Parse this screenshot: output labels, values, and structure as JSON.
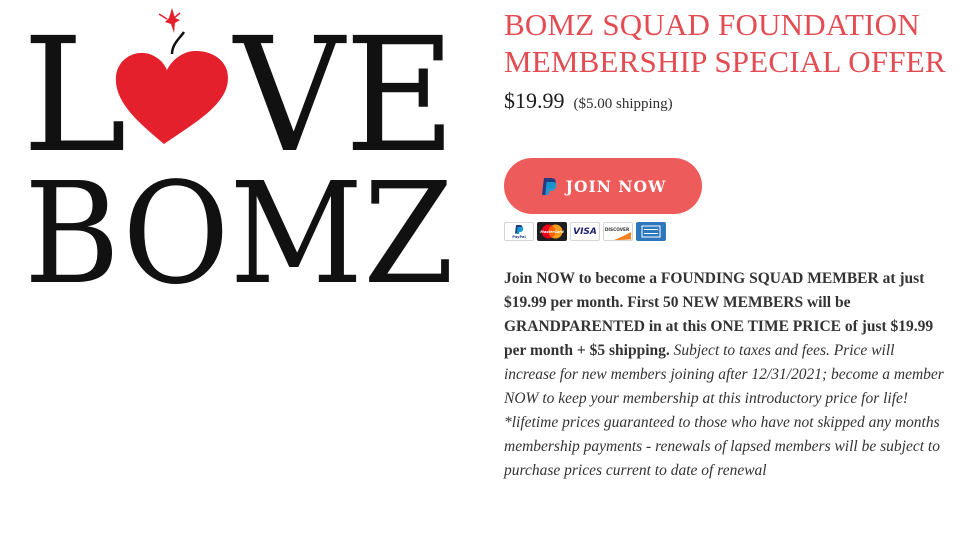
{
  "logo": {
    "line1_start": "L",
    "line1_end": "VE",
    "line2": "BOMZ",
    "heart_color": "#e3202c",
    "icon": "bomb-heart-icon"
  },
  "product": {
    "title_line1": "BOMZ SQUAD FOUNDATION",
    "title_line2": "MEMBERSHIP SPECIAL OFFER",
    "price": "$19.99",
    "shipping": "($5.00 shipping)",
    "join_label": "JOIN NOW",
    "accent_color": "#ee5b5b"
  },
  "payment_cards": [
    {
      "name": "paypal-card-icon",
      "label": "PayPal"
    },
    {
      "name": "mastercard-card-icon",
      "label": "MasterCard"
    },
    {
      "name": "visa-card-icon",
      "label": "VISA"
    },
    {
      "name": "discover-card-icon",
      "label": "DISCOVER"
    },
    {
      "name": "amex-card-icon",
      "label": ""
    }
  ],
  "description": {
    "bold_text": "Join NOW to become a FOUNDING SQUAD MEMBER at just $19.99 per month. First 50 NEW MEMBERS will be GRANDPARENTED in at this ONE TIME PRICE of just $19.99  per month + $5 shipping.",
    "italic_text": "Subject to taxes and fees. Price will increase for new members joining after 12/31/2021; become a member NOW to keep your membership at this introductory price for life! *lifetime prices guaranteed to those who have not skipped any months membership payments - renewals of lapsed members will be subject to purchase prices current to date of renewal"
  }
}
